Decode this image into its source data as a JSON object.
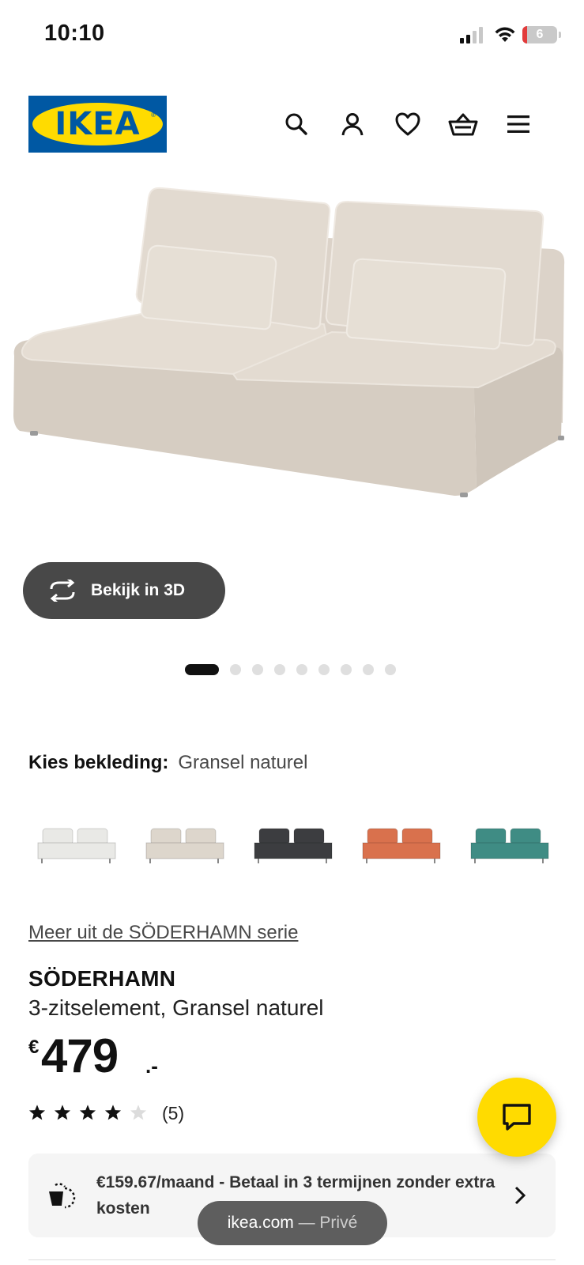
{
  "status_bar": {
    "time": "10:10",
    "battery": "6"
  },
  "header": {
    "logo_text": "IKEA",
    "icons": [
      "search-icon",
      "account-icon",
      "heart-icon",
      "basket-icon",
      "menu-icon"
    ]
  },
  "gallery": {
    "view_3d_label": "Bekijk in 3D",
    "dots_total": 9,
    "active_dot": 1
  },
  "upholstery": {
    "label": "Kies bekleding:",
    "value": "Gransel naturel",
    "swatch_colors": [
      "#e9e9e6",
      "#ddd6cc",
      "#3c3d40",
      "#d9714d",
      "#3f8c84"
    ]
  },
  "product": {
    "series_link": "Meer uit de SÖDERHAMN serie",
    "name": "SÖDERHAMN",
    "description": "3-zitselement, Gransel naturel",
    "price_currency": "€",
    "price_integer": "479",
    "price_decimal": ".-",
    "rating": 4,
    "rating_max": 5,
    "review_count": "(5)"
  },
  "payment": {
    "text": "€159.67/maand - Betaal in 3 termijnen zonder extra kosten"
  },
  "browser": {
    "domain": "ikea.com",
    "mode": "— Privé"
  },
  "colors": {
    "ikea_blue": "#0058a3",
    "ikea_yellow": "#ffdb00",
    "dark_button": "#484848"
  }
}
